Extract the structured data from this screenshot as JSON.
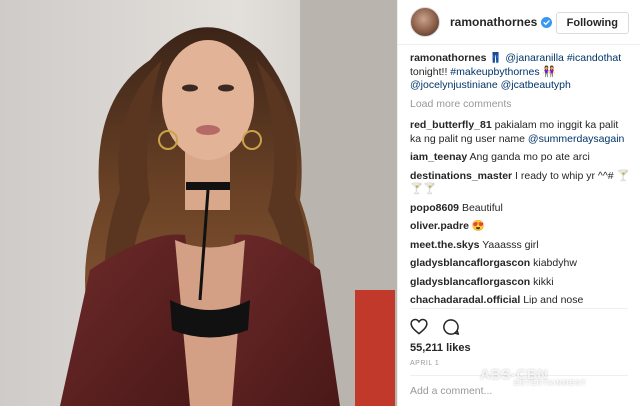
{
  "post": {
    "image_alt": "Woman with long wavy hair wearing a maroon blazer and black choker",
    "author": {
      "username": "ramonathornes",
      "follow_label": "Following",
      "avatar_icon": "profile-avatar",
      "verified_icon": "verified-badge-icon"
    },
    "caption": {
      "username": "ramonathornes",
      "segments": [
        {
          "text": "👖 ",
          "kind": "text"
        },
        {
          "text": "@janaranilla",
          "kind": "link"
        },
        {
          "text": "#icandothat",
          "kind": "link"
        },
        {
          "text": " tonight!! ",
          "kind": "text"
        },
        {
          "text": "#makeupbythornes",
          "kind": "link"
        },
        {
          "text": "👭 ",
          "kind": "text"
        },
        {
          "text": "@jocelynjustiniane",
          "kind": "link"
        },
        {
          "text": "@jcatbeautyph",
          "kind": "link"
        }
      ]
    },
    "load_more_label": "Load more comments",
    "comments": [
      {
        "username": "red_butterfly_81",
        "text": "pakialam mo inggit ka palit ka ng palit ng user name",
        "mention": "@summerdaysagain"
      },
      {
        "username": "iam_teenay",
        "text": "Ang ganda mo po ate arci",
        "mention": ""
      },
      {
        "username": "destinations_master",
        "text": "I ready to whip yr ^^# 🍸🍸🍸",
        "mention": ""
      },
      {
        "username": "popo8609",
        "text": "Beautiful",
        "mention": ""
      },
      {
        "username": "oliver.padre",
        "text": "😍",
        "mention": ""
      },
      {
        "username": "meet.the.skys",
        "text": "Yaaasss girl",
        "mention": ""
      },
      {
        "username": "gladysblancaflorgascon",
        "text": "kiabdyhw",
        "mention": ""
      },
      {
        "username": "gladysblancaflorgascon",
        "text": "kikki",
        "mention": ""
      },
      {
        "username": "chachadaradal.official",
        "text": "Lip and nose nagpadagdag sia huhuhhhhu",
        "mention": ""
      }
    ],
    "likes_label": "55,211 likes",
    "date_label": "APRIL 1",
    "add_comment_placeholder": "Add a comment...",
    "icons": {
      "like": "heart-icon",
      "comment": "comment-bubble-icon"
    }
  },
  "watermark": {
    "brand": "ABS-CBN",
    "sub": "ENTERTAINMENT"
  },
  "colors": {
    "link": "#003569",
    "muted": "#999999",
    "text": "#262626",
    "border": "#efefef",
    "verified": "#3897f0"
  }
}
